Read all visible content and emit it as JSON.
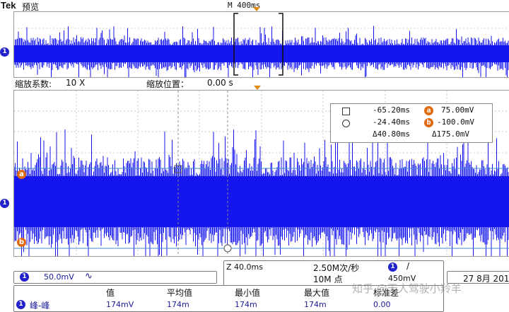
{
  "header": {
    "brand": "Tek",
    "mode": "预览",
    "timebase": "M 400ms"
  },
  "zoom_header": {
    "factor_label": "缩放系数:",
    "factor_value": "10 X",
    "position_label": "缩放位置：",
    "position_value": "0.00 s"
  },
  "channel": {
    "number": "1",
    "color": "#1515ee",
    "scale": "50.0mV",
    "coupling_icon": "ac-coupling-icon",
    "coupling_glyph": "∿"
  },
  "cursors": {
    "time1": "-65.20ms",
    "time2": "-24.40ms",
    "delta_time": "Δ40.80ms",
    "marker_a": "a",
    "marker_b": "b",
    "volt_a": "75.00mV",
    "volt_b": "-100.0mV",
    "delta_volt": "Δ175.0mV",
    "cursor_color": "#e06a10"
  },
  "acquisition": {
    "zoom_time": "Z 40.0ms",
    "sample_rate": "2.50M次/秒",
    "record_length": "10M 点",
    "trigger_channel": "1",
    "trigger_slope": "/",
    "trigger_level": "450mV"
  },
  "date": {
    "text": "27 8月 201"
  },
  "measurement": {
    "headers": [
      "值",
      "平均值",
      "最小值",
      "最大值",
      "标准差"
    ],
    "channel": "1",
    "name": "峰-峰",
    "values": [
      "174mV",
      "174m",
      "174m",
      "174m",
      "0.00"
    ]
  },
  "watermark": "知乎 @无人驾驶小羚羊"
}
